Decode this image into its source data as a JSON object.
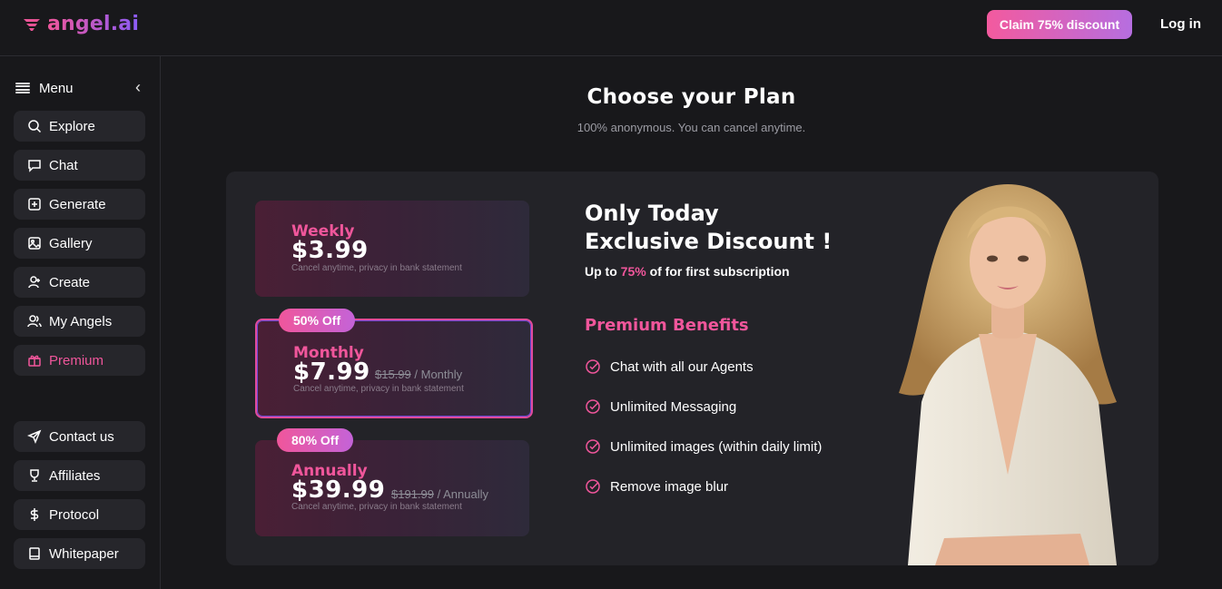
{
  "header": {
    "logo_text": "angel.ai",
    "claim_label": "Claim 75% discount",
    "login_label": "Log in"
  },
  "sidebar": {
    "menu_label": "Menu",
    "items": [
      {
        "label": "Explore",
        "icon": "search-icon"
      },
      {
        "label": "Chat",
        "icon": "chat-icon"
      },
      {
        "label": "Generate",
        "icon": "plus-square-icon"
      },
      {
        "label": "Gallery",
        "icon": "image-icon"
      },
      {
        "label": "Create",
        "icon": "user-plus-icon"
      },
      {
        "label": "My Angels",
        "icon": "users-icon"
      },
      {
        "label": "Premium",
        "icon": "gift-icon",
        "active": true
      }
    ],
    "bottom_items": [
      {
        "label": "Contact us",
        "icon": "send-icon"
      },
      {
        "label": "Affiliates",
        "icon": "trophy-icon"
      },
      {
        "label": "Protocol",
        "icon": "dollar-icon"
      },
      {
        "label": "Whitepaper",
        "icon": "book-icon"
      }
    ]
  },
  "main": {
    "title": "Choose your Plan",
    "subtitle": "100% anonymous. You can cancel anytime.",
    "plans": [
      {
        "name": "Weekly",
        "price": "$3.99",
        "old_price": "",
        "period": "",
        "note": "Cancel anytime, privacy in bank statement",
        "badge": ""
      },
      {
        "name": "Monthly",
        "price": "$7.99",
        "old_price": "$15.99",
        "period": "/ Monthly",
        "note": "Cancel anytime, privacy in bank statement",
        "badge": "50% Off",
        "selected": true
      },
      {
        "name": "Annually",
        "price": "$39.99",
        "old_price": "$191.99",
        "period": "/ Annually",
        "note": "Cancel anytime, privacy in bank statement",
        "badge": "80% Off"
      }
    ],
    "headline_line1": "Only Today",
    "headline_line2": "Exclusive Discount !",
    "upto_prefix": "Up to ",
    "upto_pct": "75%",
    "upto_suffix": " of for first subscription",
    "benefits_title": "Premium Benefits",
    "benefits": [
      "Chat with all our Agents",
      "Unlimited Messaging",
      "Unlimited images (within daily limit)",
      "Remove image blur"
    ]
  },
  "colors": {
    "accent": "#f0569b",
    "accent_purple": "#b66ee0",
    "background": "#18181b",
    "panel": "#232328"
  }
}
